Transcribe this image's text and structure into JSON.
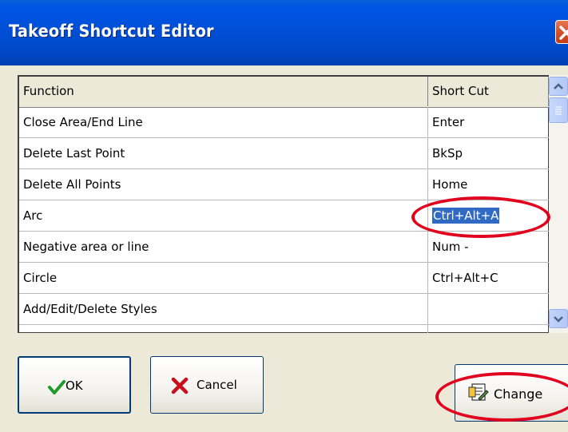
{
  "window": {
    "title": "Takeoff Shortcut Editor"
  },
  "grid": {
    "columns": [
      "Function",
      "Short Cut"
    ],
    "rows": [
      {
        "function": "Close Area/End Line",
        "shortcut": "Enter"
      },
      {
        "function": "Delete Last Point",
        "shortcut": "BkSp"
      },
      {
        "function": "Delete All Points",
        "shortcut": "Home"
      },
      {
        "function": "Arc",
        "shortcut": "Ctrl+Alt+A",
        "selected": true
      },
      {
        "function": "Negative area or line",
        "shortcut": "Num -"
      },
      {
        "function": "Circle",
        "shortcut": "Ctrl+Alt+C"
      },
      {
        "function": "Add/Edit/Delete Styles",
        "shortcut": ""
      },
      {
        "function": "",
        "shortcut": ""
      }
    ]
  },
  "buttons": {
    "ok_label": "OK",
    "cancel_label": "Cancel",
    "change_label": "Change"
  },
  "icons": {
    "ok": "checkmark-icon",
    "cancel": "x-icon",
    "change": "edit-document-icon",
    "close": "close-icon"
  },
  "colors": {
    "titlebar": "#0055e5",
    "selection": "#316ac5",
    "annotation": "#e1001e",
    "dialog_bg": "#ece9d8"
  }
}
